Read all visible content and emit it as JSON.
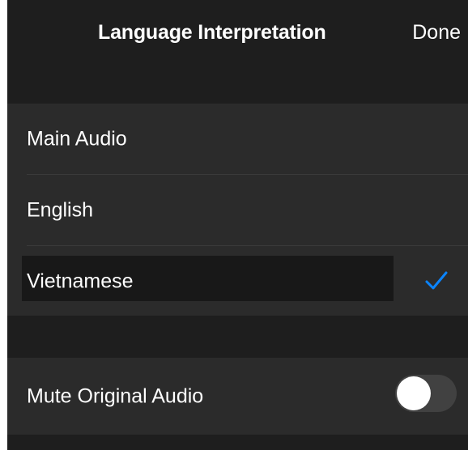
{
  "header": {
    "title": "Language Interpretation",
    "done_label": "Done"
  },
  "languages": {
    "items": [
      {
        "label": "Main Audio",
        "selected": false
      },
      {
        "label": "English",
        "selected": false
      },
      {
        "label": "Vietnamese",
        "selected": true
      }
    ],
    "check_icon": "checkmark-icon",
    "accent_color": "#0a84ff"
  },
  "mute_original": {
    "label": "Mute Original Audio",
    "enabled": false
  }
}
